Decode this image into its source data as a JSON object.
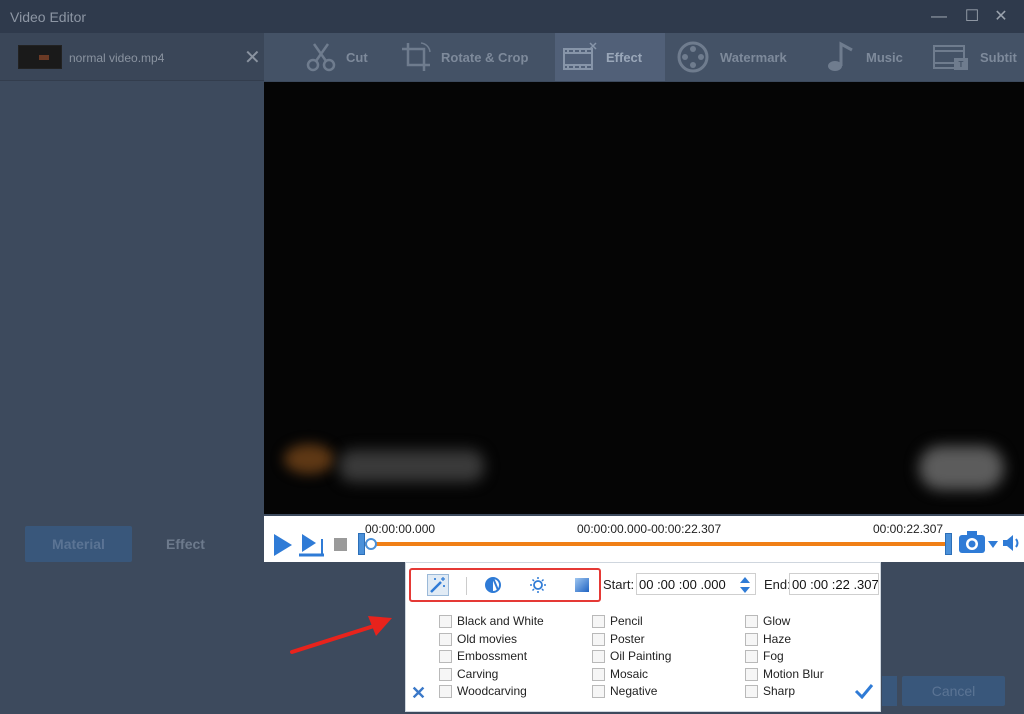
{
  "window": {
    "title": "Video Editor",
    "minimize": "—",
    "maximize": "☐",
    "close": "✕"
  },
  "file": {
    "name": "normal video.mp4",
    "close": "✕"
  },
  "tabs": [
    {
      "label": "Cut",
      "icon": "scissors-icon"
    },
    {
      "label": "Rotate & Crop",
      "icon": "crop-icon"
    },
    {
      "label": "Effect",
      "icon": "film-effect-icon",
      "active": true
    },
    {
      "label": "Watermark",
      "icon": "film-reel-icon"
    },
    {
      "label": "Music",
      "icon": "music-note-icon"
    },
    {
      "label": "Subtit",
      "icon": "subtitle-icon"
    }
  ],
  "sidebar": {
    "material_label": "Material",
    "effect_label": "Effect"
  },
  "player": {
    "start_time": "00:00:00.000",
    "range": "00:00:00.000-00:00:22.307",
    "end_time": "00:00:22.307",
    "progress": 0.0
  },
  "buttons": {
    "cancel": "Cancel"
  },
  "effect_panel": {
    "start_label": "Start:",
    "start_value": "00 :00 :00 .000",
    "end_label": "End:",
    "end_value": "00 :00 :22 .307",
    "columns": [
      [
        "Black and White",
        "Old movies",
        "Embossment",
        "Carving",
        "Woodcarving"
      ],
      [
        "Pencil",
        "Poster",
        "Oil Painting",
        "Mosaic",
        "Negative"
      ],
      [
        "Glow",
        "Haze",
        "Fog",
        "Motion Blur",
        "Sharp"
      ]
    ]
  },
  "colors": {
    "accent": "#2f7bd6",
    "track": "#f07f16",
    "highlight": "#e53935"
  }
}
